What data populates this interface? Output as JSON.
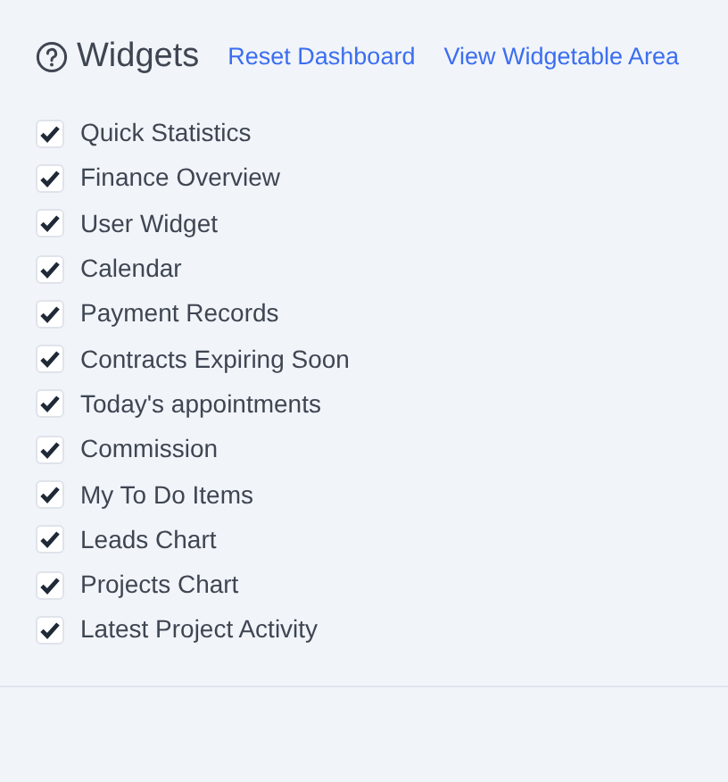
{
  "header": {
    "title": "Widgets",
    "links": [
      "Reset Dashboard",
      "View Widgetable Area"
    ]
  },
  "widgets": [
    {
      "label": "Quick Statistics",
      "checked": true
    },
    {
      "label": "Finance Overview",
      "checked": true
    },
    {
      "label": "User Widget",
      "checked": true
    },
    {
      "label": "Calendar",
      "checked": true
    },
    {
      "label": "Payment Records",
      "checked": true
    },
    {
      "label": "Contracts Expiring Soon",
      "checked": true
    },
    {
      "label": "Today's appointments",
      "checked": true
    },
    {
      "label": "Commission",
      "checked": true
    },
    {
      "label": "My To Do Items",
      "checked": true
    },
    {
      "label": "Leads Chart",
      "checked": true
    },
    {
      "label": "Projects Chart",
      "checked": true
    },
    {
      "label": "Latest Project Activity",
      "checked": true
    }
  ]
}
